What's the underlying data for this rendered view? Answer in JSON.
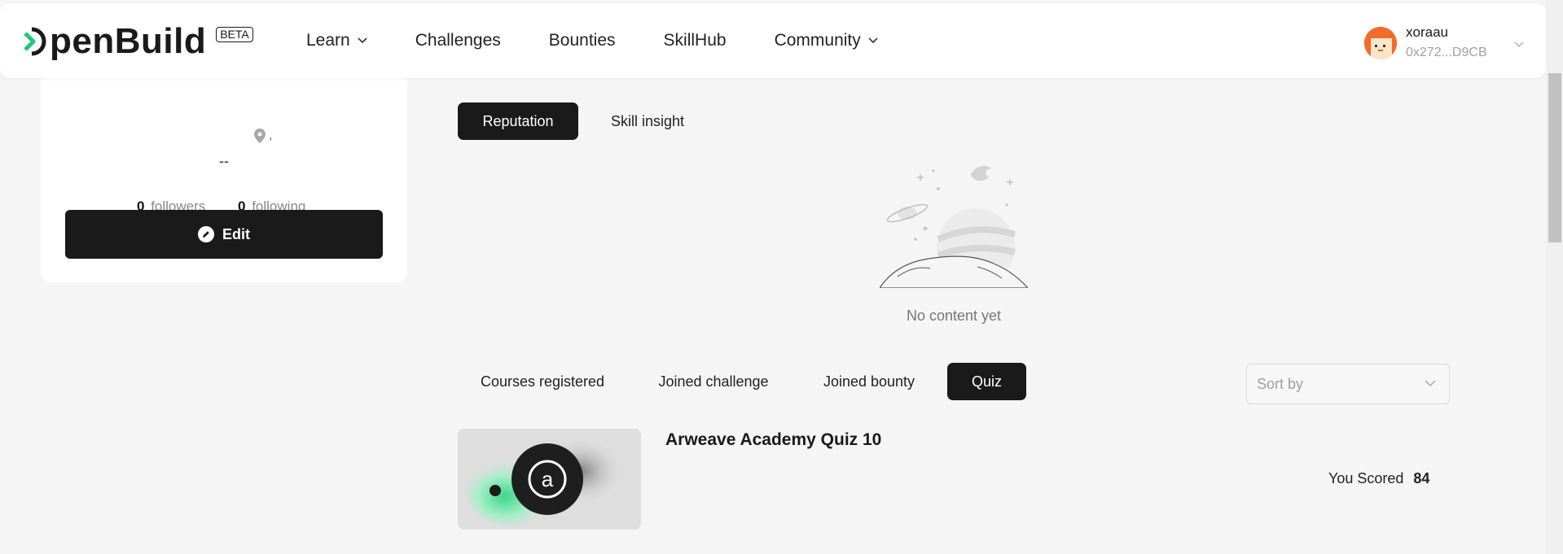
{
  "header": {
    "logo_text": "penBuild",
    "beta_label": "BETA",
    "nav": [
      {
        "label": "Learn",
        "has_dropdown": true
      },
      {
        "label": "Challenges",
        "has_dropdown": false
      },
      {
        "label": "Bounties",
        "has_dropdown": false
      },
      {
        "label": "SkillHub",
        "has_dropdown": false
      },
      {
        "label": "Community",
        "has_dropdown": true
      }
    ],
    "user": {
      "name": "xoraau",
      "address": "0x272...D9CB",
      "avatar_color": "#f26b2a"
    }
  },
  "profile": {
    "location_text": ",",
    "bio": "--",
    "followers_count": "0",
    "followers_label": "followers",
    "following_count": "0",
    "following_label": "following",
    "edit_label": "Edit"
  },
  "section_tabs": [
    {
      "label": "Reputation",
      "active": true
    },
    {
      "label": "Skill insight",
      "active": false
    }
  ],
  "empty_state": {
    "text": "No content yet"
  },
  "activity_tabs": [
    {
      "label": "Courses registered",
      "active": false
    },
    {
      "label": "Joined challenge",
      "active": false
    },
    {
      "label": "Joined bounty",
      "active": false
    },
    {
      "label": "Quiz",
      "active": true
    }
  ],
  "sort": {
    "placeholder": "Sort by"
  },
  "quiz_items": [
    {
      "title": "Arweave Academy Quiz 10",
      "score_label": "You Scored",
      "score": "84",
      "icon": "arweave-logo-icon"
    }
  ],
  "colors": {
    "accent": "#1a1a1a",
    "brand_green": "#1ec97d",
    "background": "#f5f5f5"
  }
}
